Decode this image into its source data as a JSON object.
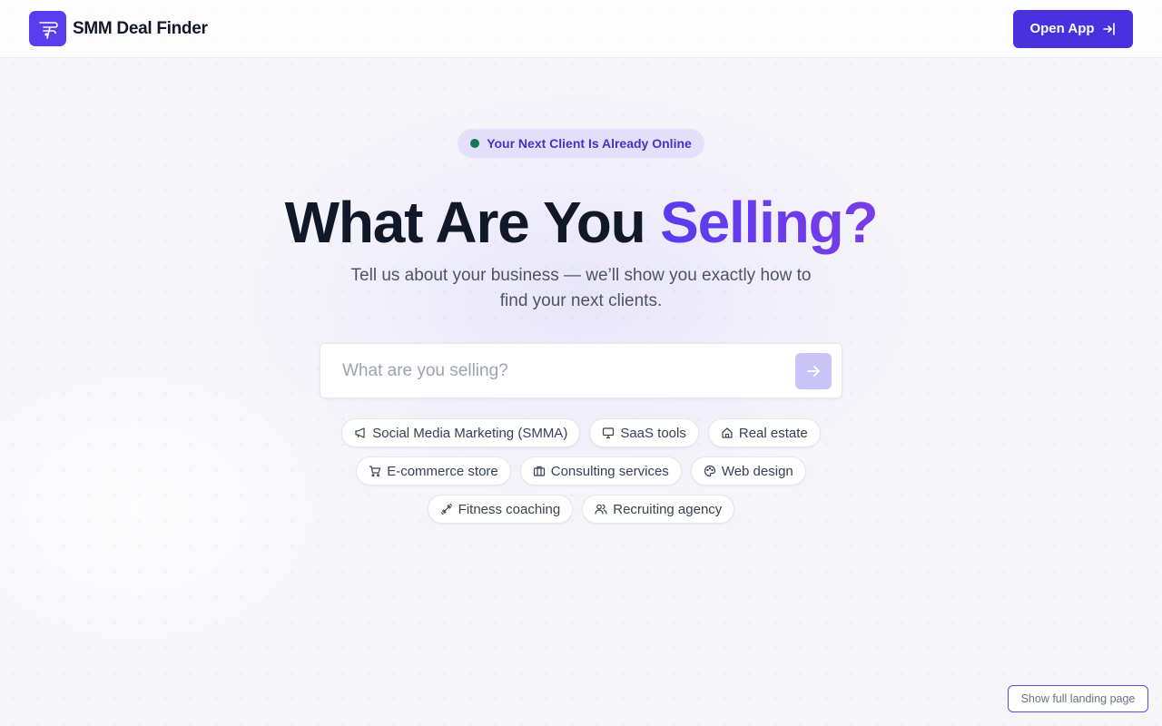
{
  "header": {
    "brand_name": "SMM Deal Finder",
    "open_app_label": "Open App"
  },
  "hero": {
    "badge_text": "Your Next Client Is Already Online",
    "title_main": "What Are You ",
    "title_accent": "Selling?",
    "subtitle_line1": "Tell us about your business — we’ll show you exactly how to",
    "subtitle_line2": "find your next clients."
  },
  "search": {
    "placeholder": "What are you selling?",
    "value": ""
  },
  "suggestions": [
    [
      {
        "label": "Social Media Marketing (SMMA)",
        "icon": "megaphone-icon"
      },
      {
        "label": "SaaS tools",
        "icon": "monitor-icon"
      },
      {
        "label": "Real estate",
        "icon": "home-icon"
      }
    ],
    [
      {
        "label": "E-commerce store",
        "icon": "cart-icon"
      },
      {
        "label": "Consulting services",
        "icon": "briefcase-icon"
      },
      {
        "label": "Web design",
        "icon": "palette-icon"
      }
    ],
    [
      {
        "label": "Fitness coaching",
        "icon": "dumbbell-icon"
      },
      {
        "label": "Recruiting agency",
        "icon": "users-icon"
      }
    ]
  ],
  "footer": {
    "landing_link": "Show full landing page"
  },
  "colors": {
    "accent": "#4a31df",
    "badge_bg": "#e4e0fb",
    "online_dot": "#0f7a55"
  }
}
